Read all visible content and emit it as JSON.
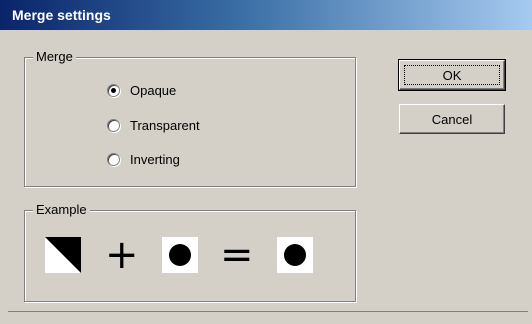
{
  "window": {
    "title": "Merge settings"
  },
  "merge_group": {
    "label": "Merge",
    "options": [
      {
        "label": "Opaque",
        "checked": true
      },
      {
        "label": "Transparent",
        "checked": false
      },
      {
        "label": "Inverting",
        "checked": false
      }
    ]
  },
  "buttons": {
    "ok": "OK",
    "cancel": "Cancel"
  },
  "example_group": {
    "label": "Example",
    "plus": "+",
    "equals": "="
  }
}
